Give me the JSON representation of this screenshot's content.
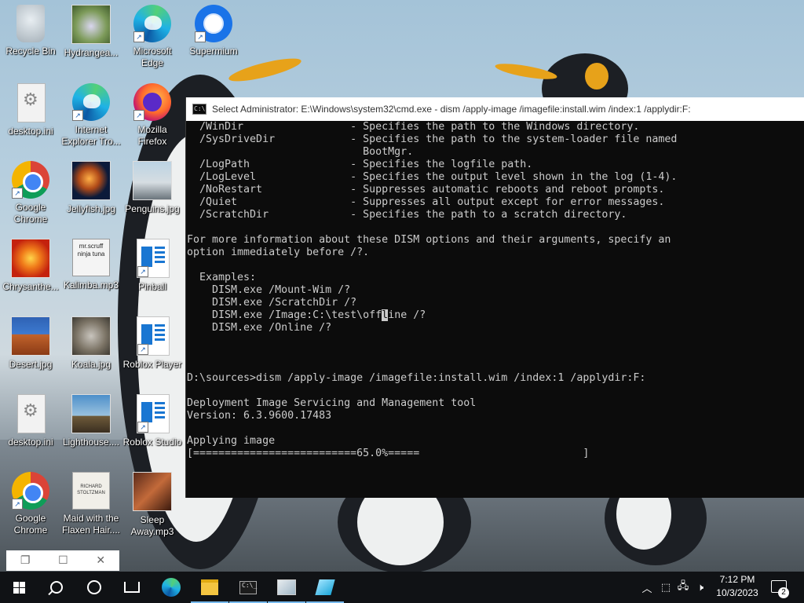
{
  "desktop": {
    "icons": [
      {
        "label": "Recycle Bin"
      },
      {
        "label": "Hydrangea..."
      },
      {
        "label": "Microsoft Edge"
      },
      {
        "label": "Supermium"
      },
      {
        "label": "desktop.ini"
      },
      {
        "label": "Internet Explorer Tro..."
      },
      {
        "label": "Mozilla Firefox"
      },
      {
        "label": "Google Chrome"
      },
      {
        "label": "Jellyfish.jpg"
      },
      {
        "label": "Penguins.jpg"
      },
      {
        "label": "Chrysanthe..."
      },
      {
        "label": "Kalimba.mp3"
      },
      {
        "label": "Pinball"
      },
      {
        "label": "Desert.jpg"
      },
      {
        "label": "Koala.jpg"
      },
      {
        "label": "Roblox Player"
      },
      {
        "label": "desktop.ini"
      },
      {
        "label": "Lighthouse...."
      },
      {
        "label": "Roblox Studio"
      },
      {
        "label": "Google Chrome"
      },
      {
        "label": "Maid with the Flaxen Hair...."
      },
      {
        "label": "Sleep Away.mp3"
      }
    ],
    "kalimba_art_text": "mr.scruff\nninja tuna",
    "maid_art_text": "RICHARD\nSTOLTZMAN"
  },
  "cmd_window": {
    "title": "Select Administrator: E:\\Windows\\system32\\cmd.exe - dism  /apply-image /imagefile:install.wim /index:1 /applydir:F:",
    "lines_before_cursor": "  /WinDir                 - Specifies the path to the Windows directory.\n  /SysDriveDir            - Specifies the path to the system-loader file named\n                            BootMgr.\n  /LogPath                - Specifies the logfile path.\n  /LogLevel               - Specifies the output level shown in the log (1-4).\n  /NoRestart              - Suppresses automatic reboots and reboot prompts.\n  /Quiet                  - Suppresses all output except for error messages.\n  /ScratchDir             - Specifies the path to a scratch directory.\n\nFor more information about these DISM options and their arguments, specify an\noption immediately before /?.\n\n  Examples:\n    DISM.exe /Mount-Wim /?\n    DISM.exe /ScratchDir /?\n    DISM.exe /Image:C:\\test\\off",
    "cursor_char": "l",
    "lines_after_cursor": "ine /?\n    DISM.exe /Online /?\n\n\n\nD:\\sources>dism /apply-image /imagefile:install.wim /index:1 /applydir:F:\n\nDeployment Image Servicing and Management tool\nVersion: 6.3.9600.17483\n\nApplying image\n[==========================65.0%=====                          ]"
  },
  "taskbar": {
    "apps": [
      {
        "name": "Start"
      },
      {
        "name": "Search"
      },
      {
        "name": "Cortana"
      },
      {
        "name": "Task View"
      },
      {
        "name": "Microsoft Edge"
      },
      {
        "name": "File Explorer"
      },
      {
        "name": "Command Prompt"
      },
      {
        "name": "Image viewer"
      },
      {
        "name": "Pen tool"
      }
    ],
    "time": "7:12 PM",
    "date": "10/3/2023",
    "notification_count": "2"
  },
  "minimized": {
    "restore_glyph": "❐",
    "maximize_glyph": "☐",
    "close_glyph": "✕"
  }
}
